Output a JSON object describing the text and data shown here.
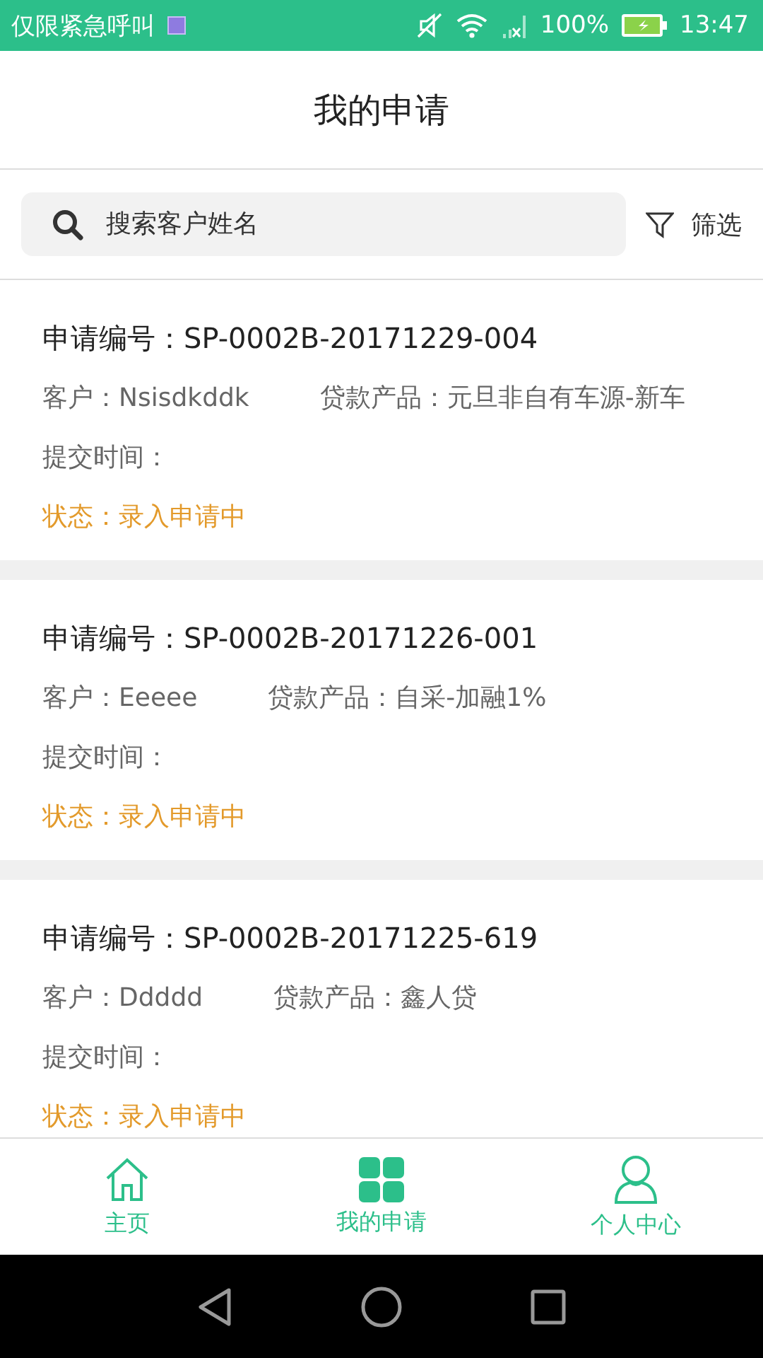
{
  "status_bar": {
    "carrier": "仅限紧急呼叫",
    "battery": "100%",
    "time": "13:47"
  },
  "header": {
    "title": "我的申请"
  },
  "search": {
    "placeholder": "搜索客户姓名",
    "filter_label": "筛选"
  },
  "applications": [
    {
      "number": "申请编号：SP-0002B-20171229-004",
      "customer": "客户：Nsisdkddk",
      "product": "贷款产品：元旦非自有车源-新车",
      "submitted": "提交时间：",
      "status": "状态：录入申请中"
    },
    {
      "number": "申请编号：SP-0002B-20171226-001",
      "customer": "客户：Eeeee",
      "product": "贷款产品：自采-加融1%",
      "submitted": "提交时间：",
      "status": "状态：录入申请中"
    },
    {
      "number": "申请编号：SP-0002B-20171225-619",
      "customer": "客户：Ddddd",
      "product": "贷款产品：鑫人贷",
      "submitted": "提交时间：",
      "status": "状态：录入申请中"
    }
  ],
  "bottom_nav": [
    {
      "kind": "home",
      "label": "主页",
      "selected": false
    },
    {
      "kind": "grid",
      "label": "我的申请",
      "selected": true
    },
    {
      "kind": "person",
      "label": "个人中心",
      "selected": false
    }
  ]
}
